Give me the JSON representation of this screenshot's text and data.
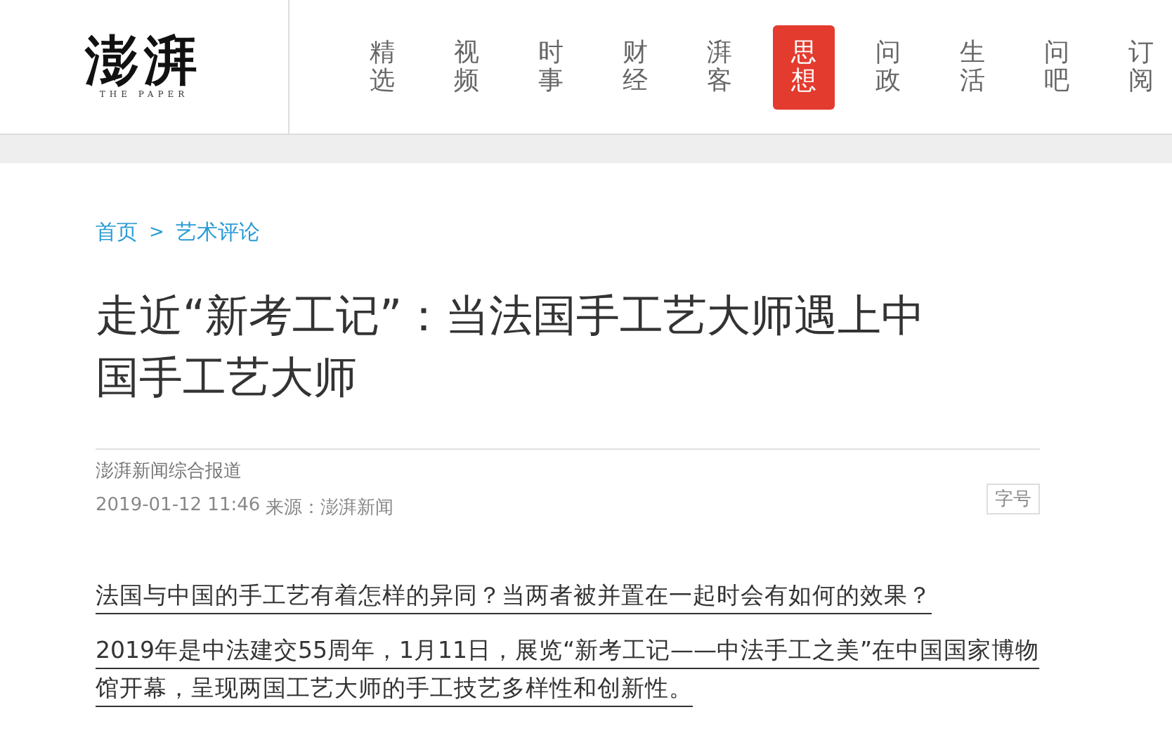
{
  "logo": {
    "title": "澎湃",
    "subtitle": "THE PAPER"
  },
  "nav": [
    {
      "label": "精选",
      "selected": false
    },
    {
      "label": "视频",
      "selected": false
    },
    {
      "label": "时事",
      "selected": false
    },
    {
      "label": "财经",
      "selected": false
    },
    {
      "label": "湃客",
      "selected": false
    },
    {
      "label": "思想",
      "selected": true
    },
    {
      "label": "问政",
      "selected": false
    },
    {
      "label": "生活",
      "selected": false
    },
    {
      "label": "问吧",
      "selected": false
    },
    {
      "label": "订阅",
      "selected": false
    }
  ],
  "breadcrumb": {
    "items": [
      "首页",
      "艺术评论"
    ],
    "separator": ">"
  },
  "article": {
    "title": "走近“新考工记”：当法国手工艺大师遇上中国手工艺大师",
    "byline": "澎湃新闻综合报道",
    "date": "2019-01-12 11:46",
    "source": "来源：澎湃新闻",
    "font_size_button": "字号",
    "paragraphs": [
      "法国与中国的手工艺有着怎样的异同？当两者被并置在一起时会有如何的效果？",
      "2019年是中法建交55周年，1月11日，展览“新考工记——中法手工之美”在中国国家博物馆开幕，呈现两国工艺大师的手工技艺多样性和创新性。"
    ]
  }
}
